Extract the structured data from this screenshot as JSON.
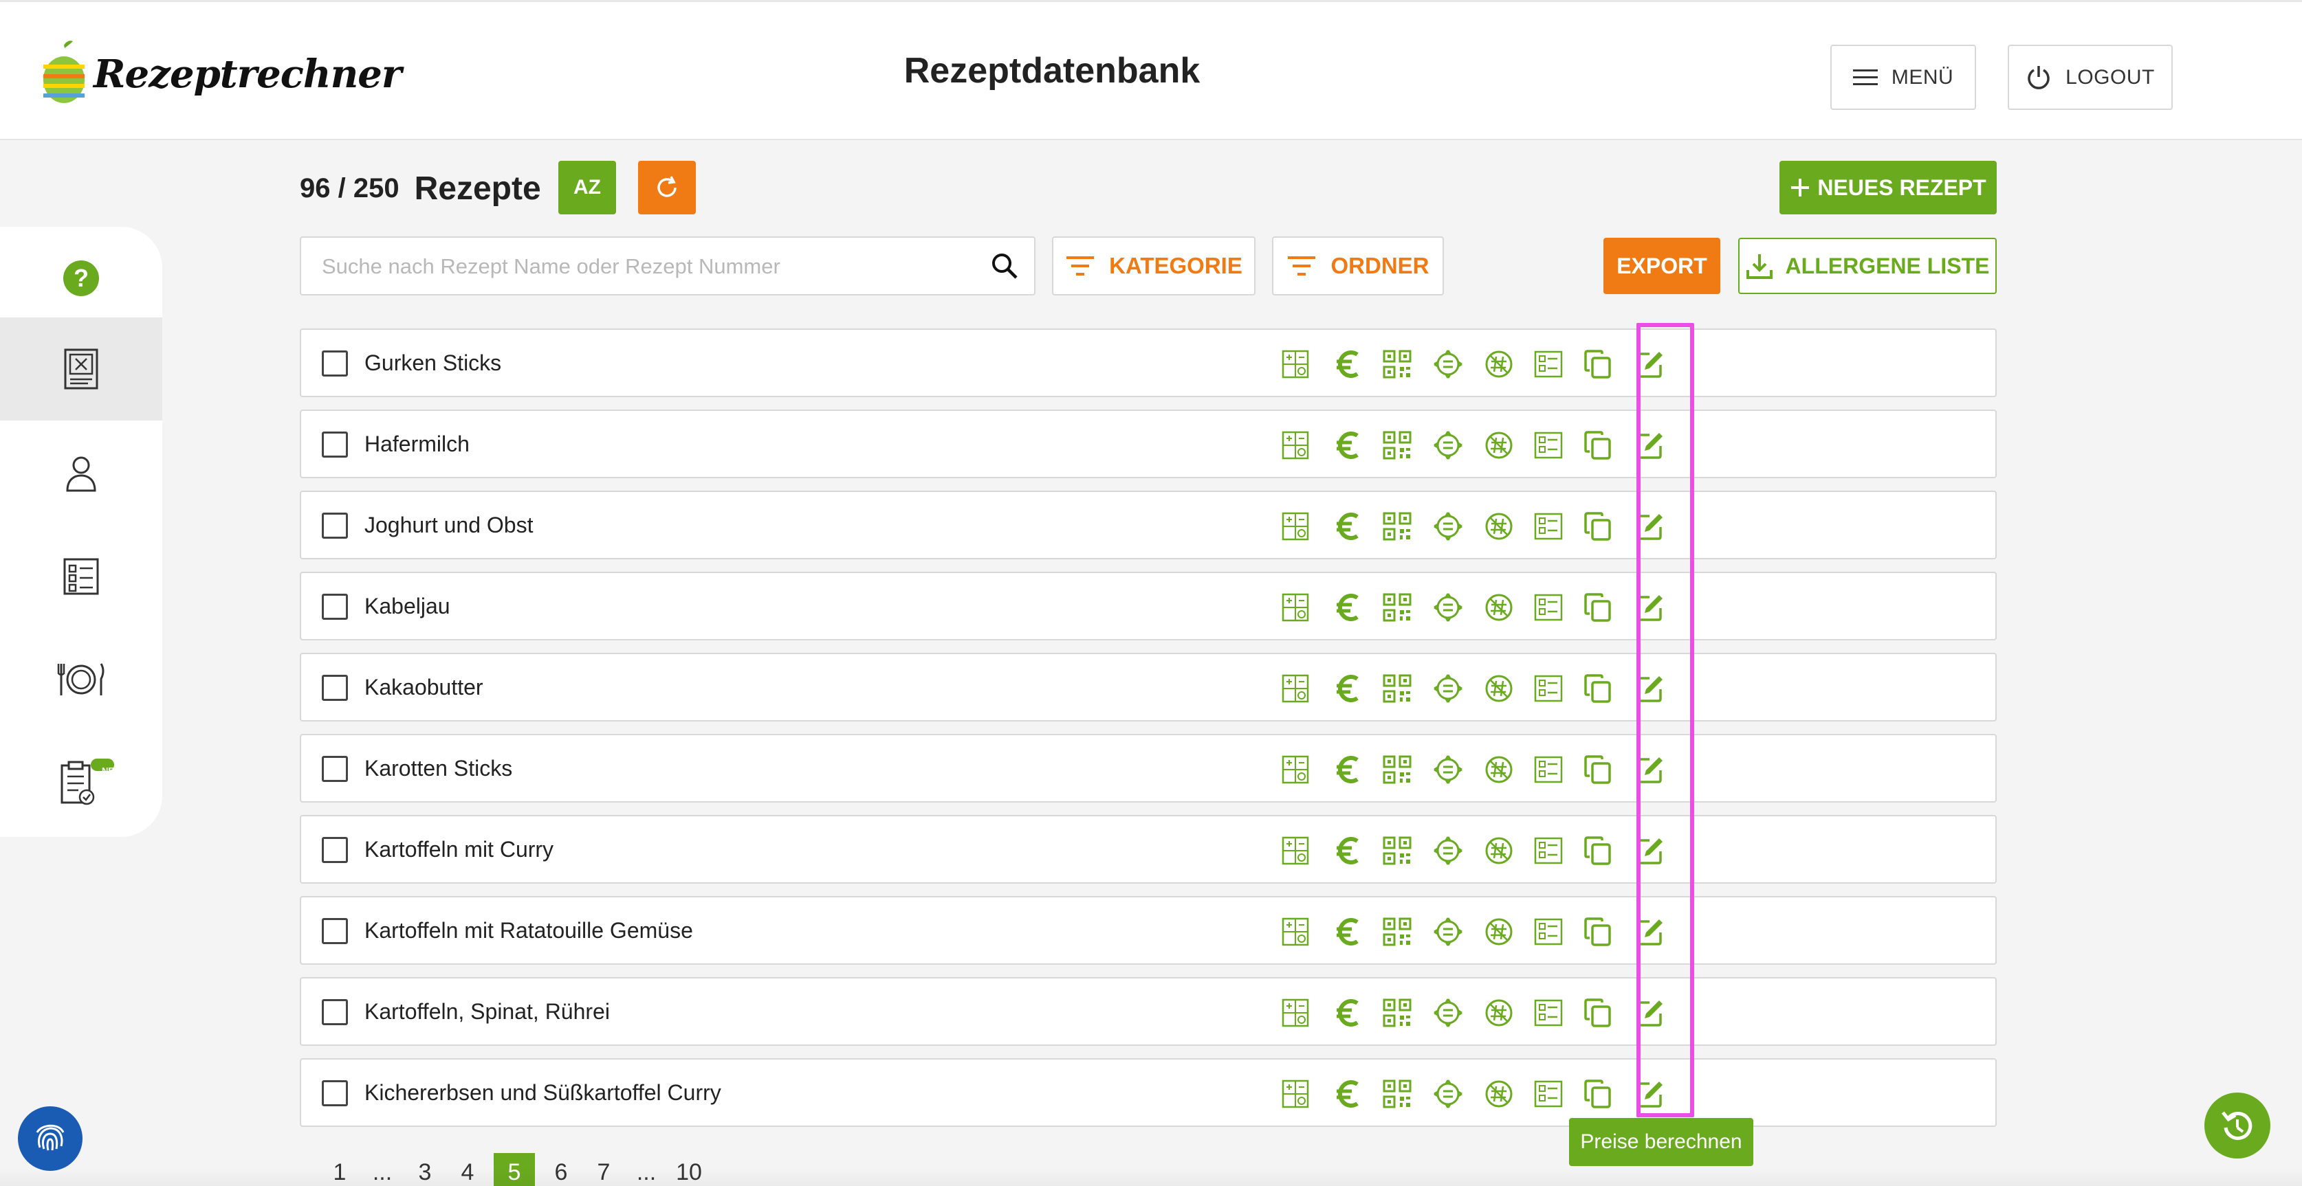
{
  "app": {
    "logo_text": "Rezeptrechner",
    "page_title": "Rezeptdatenbank"
  },
  "header": {
    "menu_label": "MENÜ",
    "logout_label": "LOGOUT"
  },
  "sidebar": {
    "items": [
      {
        "icon": "help-icon"
      },
      {
        "icon": "recipe-book-icon",
        "active": true
      },
      {
        "icon": "user-icon"
      },
      {
        "icon": "checklist-icon"
      },
      {
        "icon": "plate-cutlery-icon"
      },
      {
        "icon": "clipboard-check-icon",
        "badge": "NEU"
      }
    ]
  },
  "toolbar": {
    "count": "96 / 250",
    "count_label": "Rezepte",
    "sort_label": "AZ",
    "new_recipe_label": "NEUES REZEPT",
    "search_placeholder": "Suche nach Rezept Name oder Rezept Nummer",
    "category_label": "KATEGORIE",
    "folder_label": "ORDNER",
    "export_label": "EXPORT",
    "allergen_label": "ALLERGENE LISTE"
  },
  "recipes": [
    "Gurken Sticks",
    "Hafermilch",
    "Joghurt und Obst",
    "Kabeljau",
    "Kakaobutter",
    "Karotten Sticks",
    "Kartoffeln mit Curry",
    "Kartoffeln mit Ratatouille Gemüse",
    "Kartoffeln, Spinat, Rührei",
    "Kichererbsen und Süßkartoffel Curry"
  ],
  "row_actions": [
    "calculator-icon",
    "euro-icon",
    "qr-code-icon",
    "nutrition-seal-icon",
    "no-hashtag-icon",
    "label-list-icon",
    "copy-icon",
    "edit-icon"
  ],
  "tooltip": "Preise berechnen",
  "pagination": {
    "pages": [
      "1",
      "...",
      "3",
      "4",
      "5",
      "6",
      "7",
      "...",
      "10"
    ],
    "current": "5"
  },
  "colors": {
    "green": "#6aaa1f",
    "orange": "#f07b14",
    "highlight": "#ec4de6",
    "blue": "#1a5cb3"
  }
}
